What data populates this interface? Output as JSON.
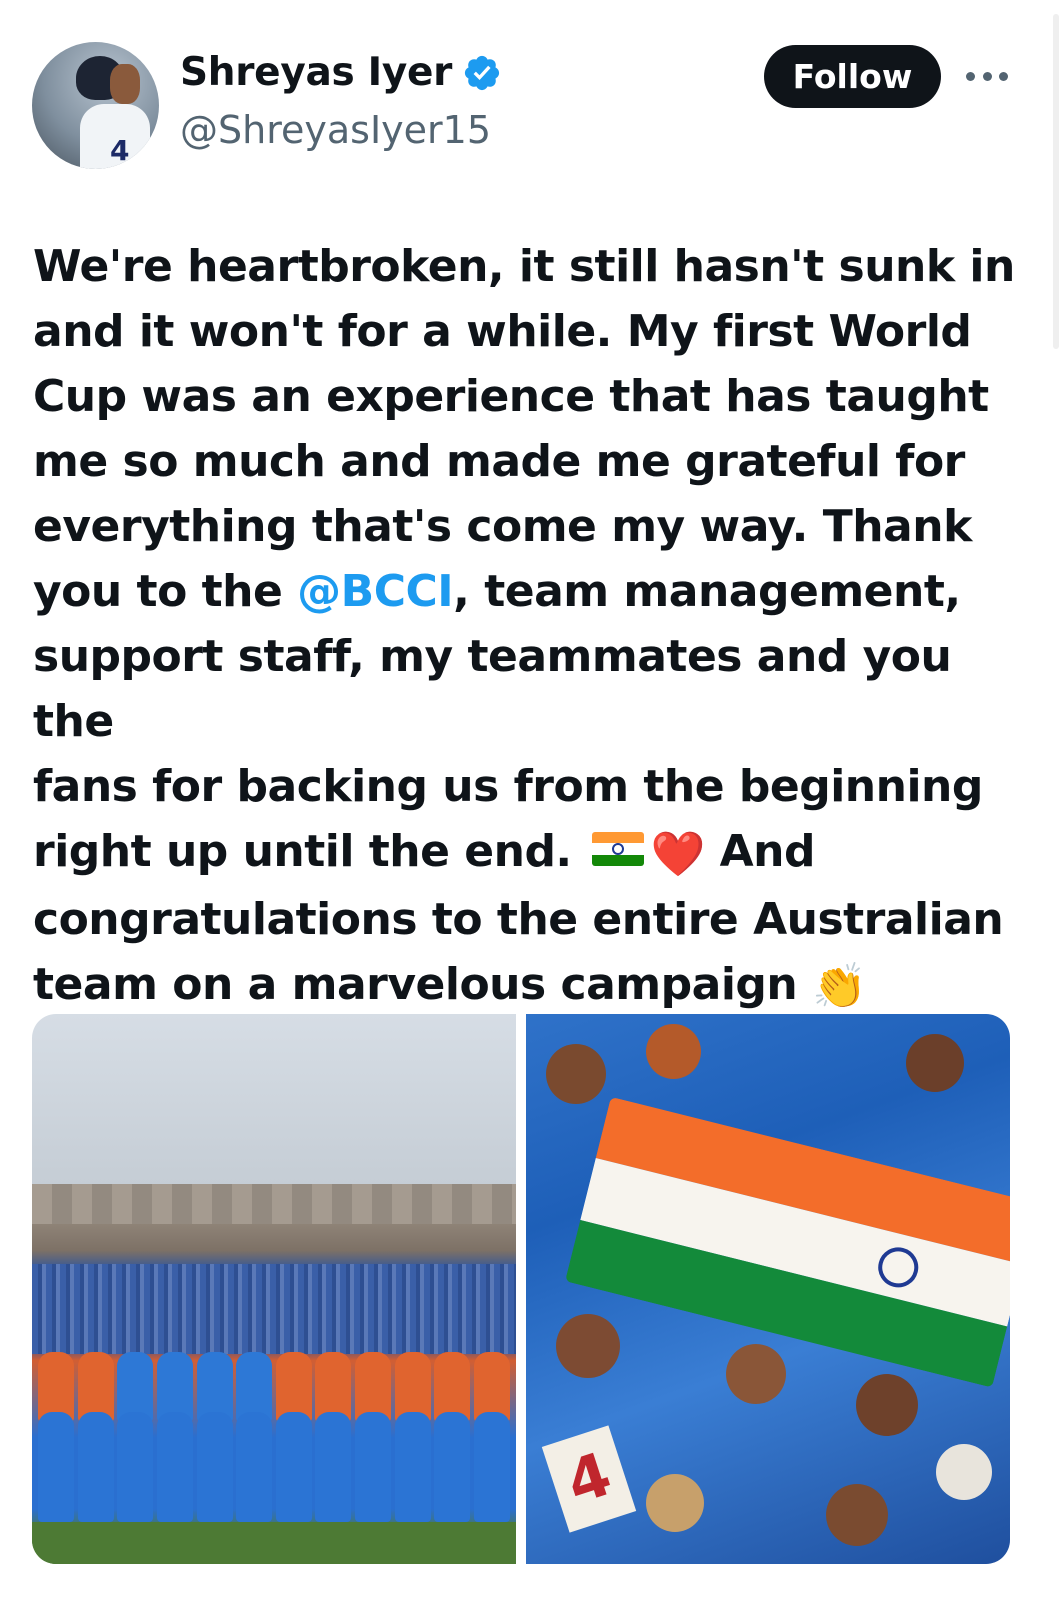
{
  "author": {
    "name": "Shreyas Iyer",
    "handle": "@ShreyasIyer15",
    "verified": true,
    "avatar_jersey_number": "4"
  },
  "actions": {
    "follow_label": "Follow",
    "more_icon": "more-horizontal-icon"
  },
  "tweet": {
    "line1": "We're heartbroken, it still hasn't sunk in",
    "line2": "and it won't for a while. My first World",
    "line3": "Cup was an experience that has taught",
    "line4": "me so much and made me grateful for",
    "line5": "everything that's come my way. Thank",
    "line6_before": "you to the ",
    "mention": "@BCCI",
    "line6_after": ", team management,",
    "line7": "support staff, my teammates and you the",
    "line8": "fans for backing us from the beginning",
    "line9": "right up until the end.",
    "heart_emoji": "❤️",
    "line9_after": "And",
    "line10": "congratulations to the entire Australian",
    "line11": "team on a marvelous campaign",
    "clap_emoji": "👏"
  },
  "media": {
    "photos": [
      "team-photo",
      "fans-photo"
    ],
    "fan_sign_text": "4"
  },
  "colors": {
    "accent": "#1d9bf0",
    "text": "#0f1419",
    "secondary_text": "#536471",
    "follow_bg": "#0f1419"
  }
}
